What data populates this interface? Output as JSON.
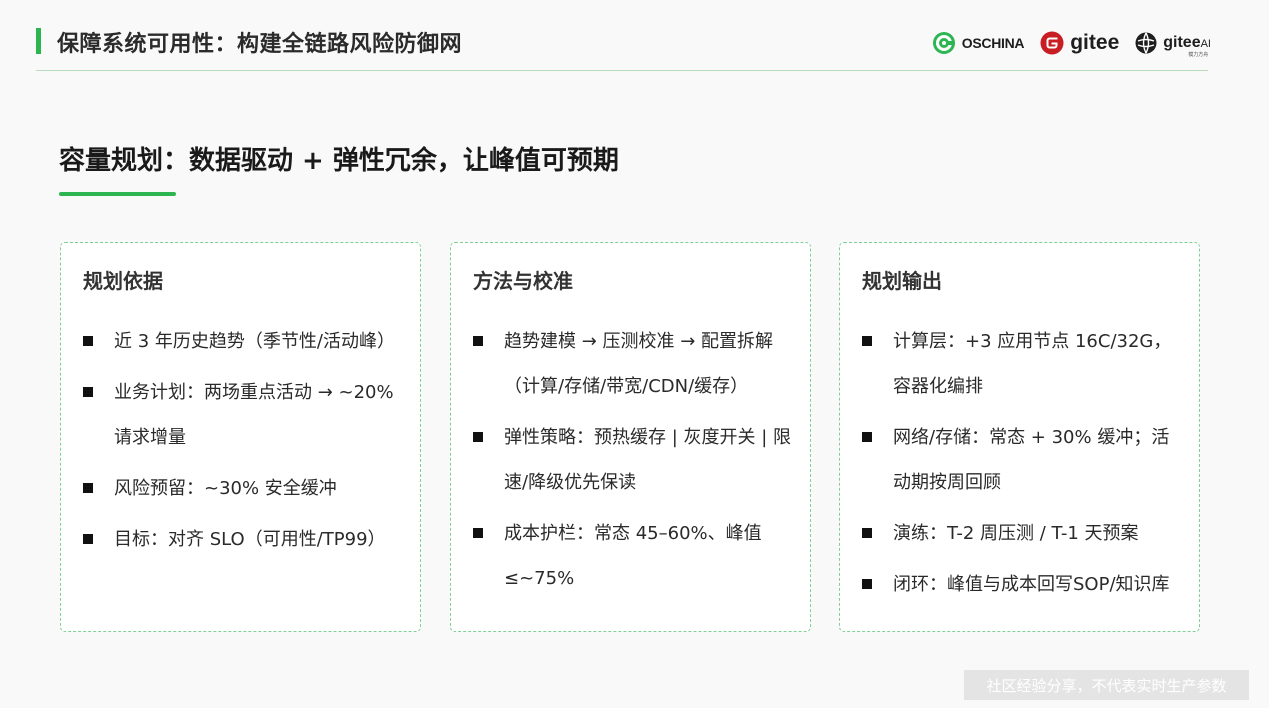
{
  "header": {
    "title": "保障系统可用性：构建全链路风险防御网",
    "accent_color": "#2db552"
  },
  "logos": {
    "oschina": "OSCHINA",
    "gitee": "gitee",
    "gitee_ai": "gitee",
    "gitee_ai_suffix": "AI",
    "gitee_ai_tagline": "模力方舟"
  },
  "slide": {
    "title": "容量规划：数据驱动 + 弹性冗余，让峰值可预期"
  },
  "cards": [
    {
      "title": "规划依据",
      "items": [
        "近 3 年历史趋势（季节性/活动峰）",
        "业务计划：两场重点活动 → ~20% 请求增量",
        "风险预留：~30% 安全缓冲",
        "目标：对齐 SLO（可用性/TP99）"
      ]
    },
    {
      "title": "方法与校准",
      "items": [
        "趋势建模 → 压测校准 → 配置拆解（计算/存储/带宽/CDN/缓存）",
        "弹性策略：预热缓存 | 灰度开关 | 限速/降级优先保读",
        "成本护栏：常态 45–60%、峰值 ≤~75%"
      ]
    },
    {
      "title": "规划输出",
      "items": [
        "计算层：+3 应用节点 16C/32G，容器化编排",
        "网络/存储：常态 + 30% 缓冲；活动期按周回顾",
        "演练：T-2 周压测 / T-1 天预案",
        "闭环：峰值与成本回写SOP/知识库"
      ]
    }
  ],
  "footer": {
    "note": "社区经验分享，不代表实时生产参数"
  }
}
